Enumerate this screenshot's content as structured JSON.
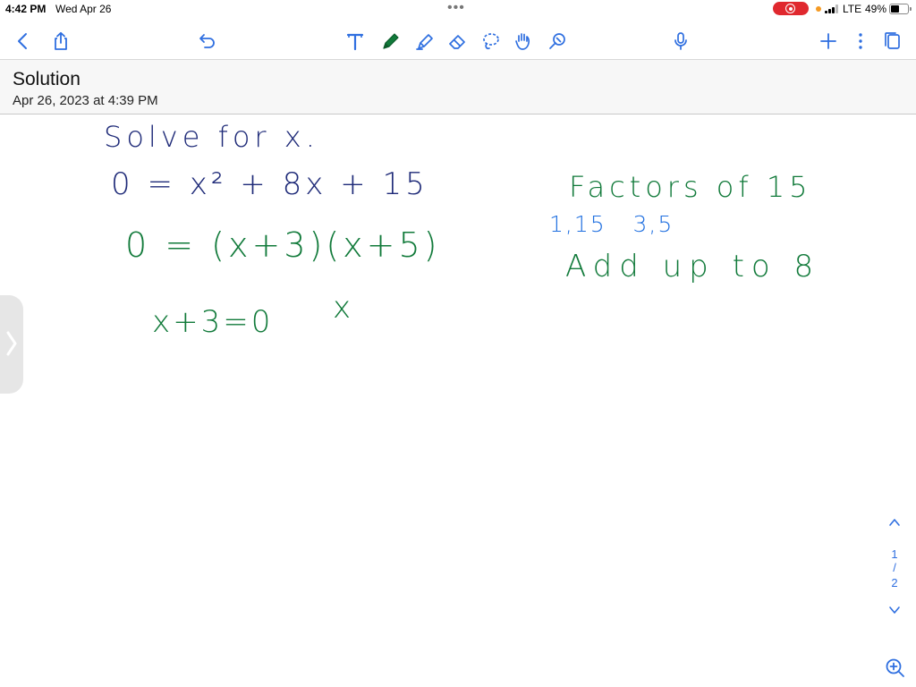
{
  "status_bar": {
    "time": "4:42 PM",
    "date": "Wed Apr 26",
    "network": "LTE",
    "battery": "49%"
  },
  "toolbar": {
    "icons": [
      "back-icon",
      "share-icon",
      "undo-icon",
      "text-tool-icon",
      "pen-icon",
      "highlighter-icon",
      "eraser-icon",
      "lasso-icon",
      "hand-icon",
      "pencil-tip-icon",
      "microphone-icon",
      "add-icon",
      "more-icon",
      "pages-icon"
    ]
  },
  "note": {
    "title": "Solution",
    "subtitle": "Apr 26, 2023 at 4:39 PM"
  },
  "handwriting": {
    "line1": "Solve for x.",
    "line2": "0 = x² + 8x + 15",
    "line3": "0 = (x+3)(x+5)",
    "line4a": "x+3=0",
    "line4b": "x",
    "factors_title": "Factors of 15",
    "factors_list": "1,15   3,5",
    "add_up": "Add up to 8"
  },
  "pager": {
    "current": "1",
    "separator": "/",
    "total": "2"
  },
  "colors": {
    "navy_ink": "#1e2a78",
    "green_ink": "#117a3a",
    "blue_ink": "#1f6fe0",
    "accent": "#2f6fe0"
  }
}
